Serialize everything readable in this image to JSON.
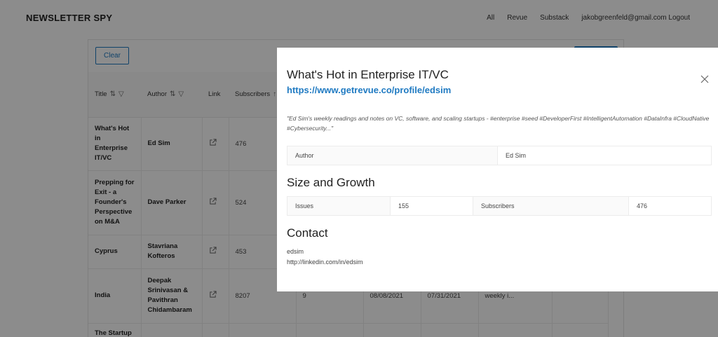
{
  "navbar": {
    "brand": "NEWSLETTER SPY",
    "links": [
      "All",
      "Revue",
      "Substack",
      "jakobgreenfeld@gmail.com Logout"
    ]
  },
  "table": {
    "clear_label": "Clear",
    "columns": [
      "Title",
      "Author",
      "Link",
      "Subscribers"
    ],
    "rows": [
      {
        "title": "What's Hot in Enterprise IT/VC",
        "author": "Ed Sim",
        "subscribers": "476",
        "extra": []
      },
      {
        "title": "Prepping for Exit - a Founder's Perspective on M&A",
        "author": "Dave Parker",
        "subscribers": "524",
        "extra": []
      },
      {
        "title": "Cyprus",
        "author": "Stavriana Kofteros",
        "subscribers": "453",
        "extra": []
      },
      {
        "title": "India",
        "author": "Deepak Srinivasan & Pavithran Chidambaram",
        "subscribers": "8207",
        "extra": [
          "9",
          "08/08/2021",
          "07/31/2021",
          "weekly i..."
        ]
      },
      {
        "title": "The Startup",
        "author": "",
        "subscribers": "",
        "extra": []
      }
    ]
  },
  "modal": {
    "title": "What's Hot in Enterprise IT/VC",
    "link": "https://www.getrevue.co/profile/edsim",
    "description": "\"Ed Sim's weekly readings and notes on VC, software, and scaling startups - #enterprise #seed #DeveloperFirst #IntelligentAutomation #DataInfra #CloudNative #Cybersecurity...\"",
    "author_label": "Author",
    "author_value": "Ed Sim",
    "size_heading": "Size and Growth",
    "issues_label": "Issues",
    "issues_value": "155",
    "subscribers_label": "Subscribers",
    "subscribers_value": "476",
    "contact_heading": "Contact",
    "contact_lines": [
      "edsim",
      "http://linkedin.com/in/edsim"
    ]
  },
  "colors": {
    "accent": "#1f7ac2",
    "overlay": "rgba(0,0,0,0.45)"
  }
}
